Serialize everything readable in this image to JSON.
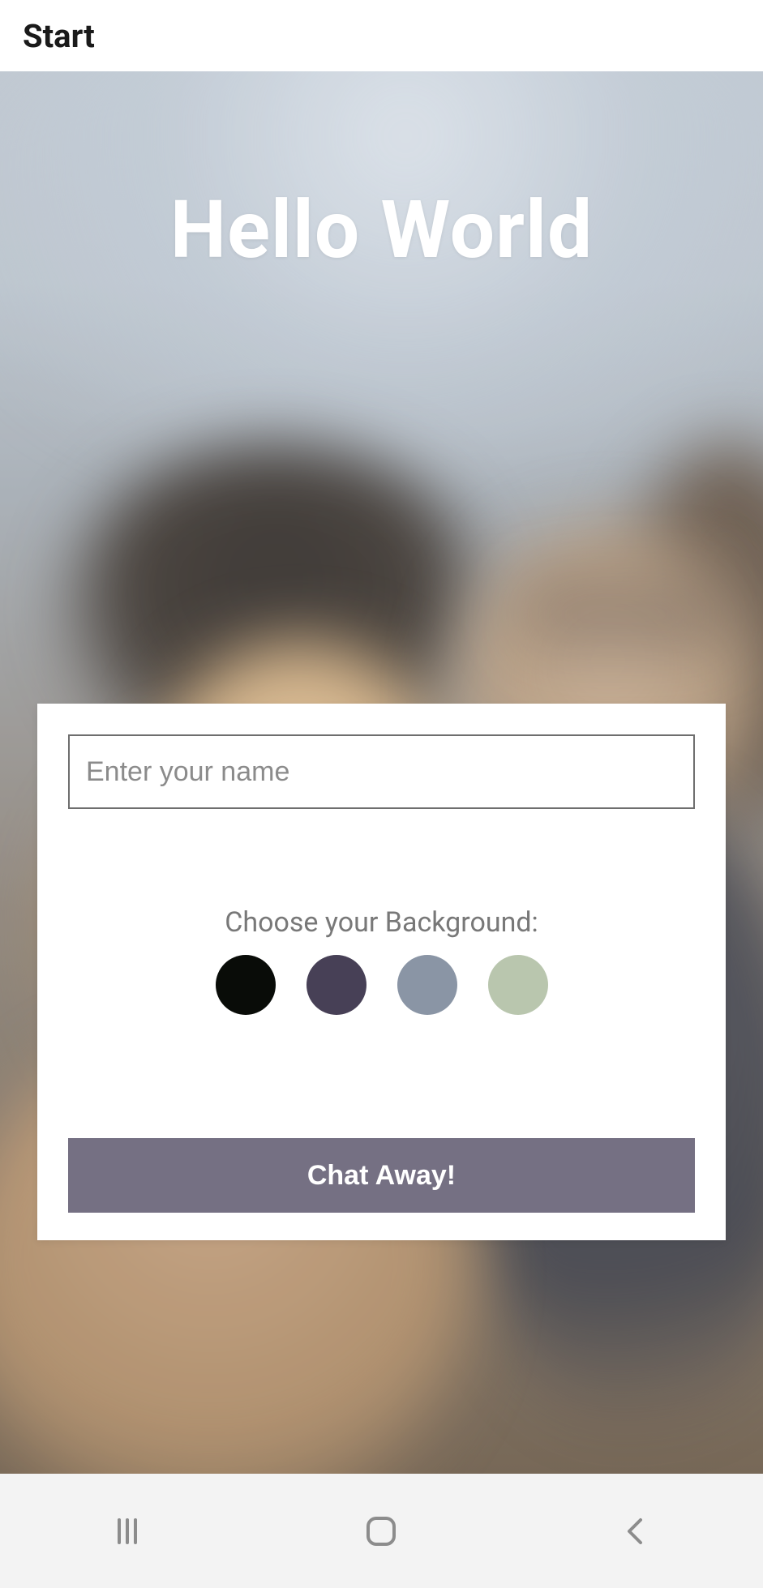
{
  "header": {
    "title": "Start"
  },
  "hero": {
    "title": "Hello World"
  },
  "form": {
    "name_value": "",
    "name_placeholder": "Enter your name",
    "background_label": "Choose your Background:",
    "colors": {
      "opt1": "#090c08",
      "opt2": "#474056",
      "opt3": "#8a95a5",
      "opt4": "#b9c6ae"
    },
    "chat_button": "Chat Away!"
  },
  "nav": {
    "recents_icon": "recents",
    "home_icon": "home",
    "back_icon": "back"
  }
}
